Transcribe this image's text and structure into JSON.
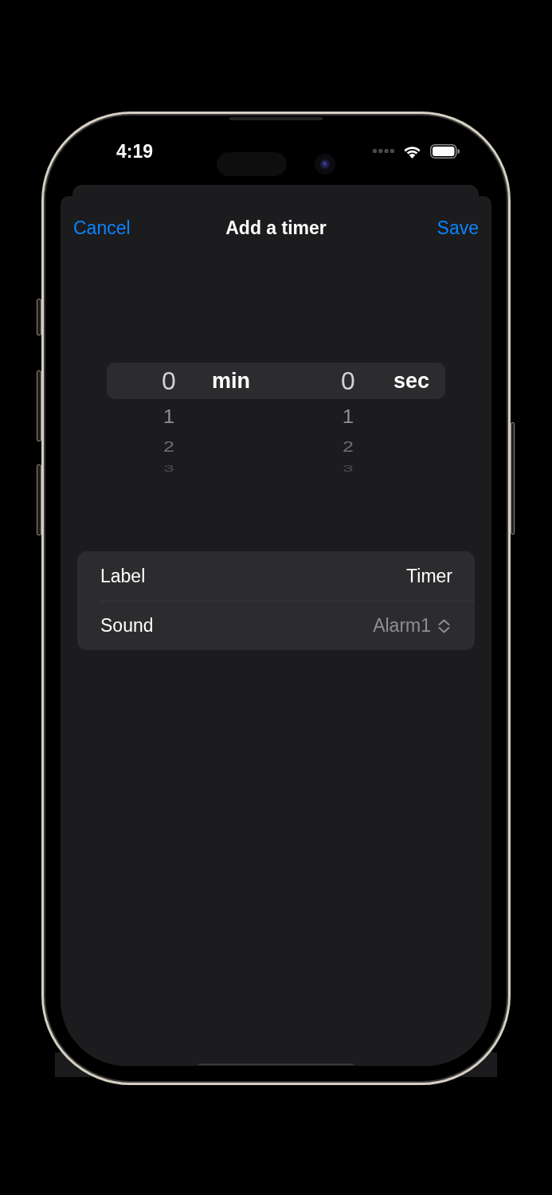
{
  "status_bar": {
    "time": "4:19"
  },
  "sheet": {
    "nav": {
      "cancel": "Cancel",
      "title": "Add a timer",
      "save": "Save"
    },
    "picker": {
      "columns": [
        {
          "unit": "min",
          "items": [
            {
              "value": "0",
              "selected": true
            },
            {
              "value": "1",
              "selected": false
            },
            {
              "value": "2",
              "selected": false
            },
            {
              "value": "3",
              "selected": false
            }
          ]
        },
        {
          "unit": "sec",
          "items": [
            {
              "value": "0",
              "selected": true
            },
            {
              "value": "1",
              "selected": false
            },
            {
              "value": "2",
              "selected": false
            },
            {
              "value": "3",
              "selected": false
            }
          ]
        }
      ]
    },
    "form": {
      "rows": [
        {
          "kind": "text",
          "label": "Label",
          "value": "Timer"
        },
        {
          "kind": "menu",
          "label": "Sound",
          "value": "Alarm1"
        }
      ]
    }
  }
}
